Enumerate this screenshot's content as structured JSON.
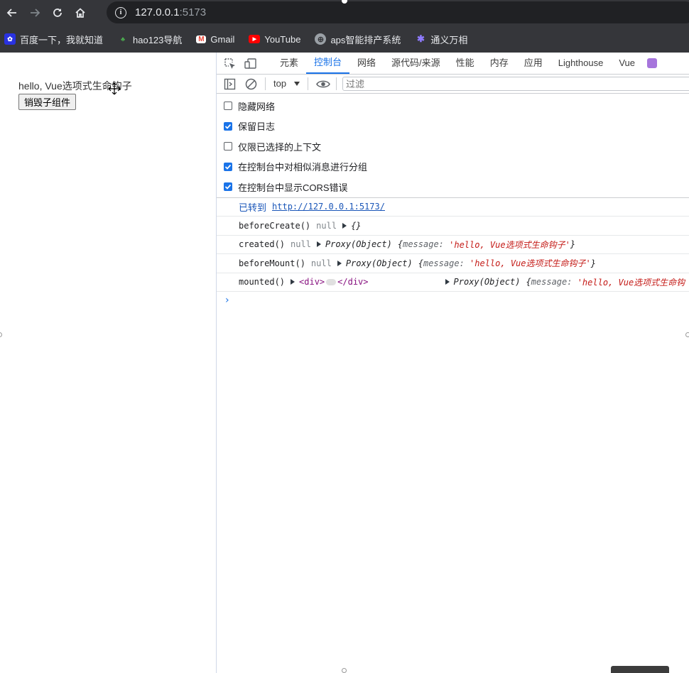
{
  "browser": {
    "url_host": "127.0.0.1",
    "url_port": ":5173",
    "bookmarks": [
      {
        "label": "百度一下，我就知道",
        "icon": "baidu-paw-icon",
        "color": "#2932e1"
      },
      {
        "label": "hao123导航",
        "icon": "hao123-icon",
        "color": "#e8a93a"
      },
      {
        "label": "Gmail",
        "icon": "gmail-icon",
        "color": "#ea4335"
      },
      {
        "label": "YouTube",
        "icon": "youtube-icon",
        "color": "#ff0000"
      },
      {
        "label": "aps智能排产系统",
        "icon": "globe-icon",
        "color": "#9aa0a6"
      },
      {
        "label": "通义万相",
        "icon": "tongyi-icon",
        "color": "#7b61ff"
      }
    ]
  },
  "page": {
    "text": "hello, Vue选项式生命钩子",
    "button_label": "销毁子组件"
  },
  "devtools": {
    "tabs": [
      "元素",
      "控制台",
      "网络",
      "源代码/来源",
      "性能",
      "内存",
      "应用",
      "Lighthouse",
      "Vue"
    ],
    "active_tab": "控制台",
    "context": "top",
    "filter_placeholder": "过滤",
    "settings": [
      {
        "label": "隐藏网络",
        "checked": false
      },
      {
        "label": "保留日志",
        "checked": true
      },
      {
        "label": "仅限已选择的上下文",
        "checked": false
      },
      {
        "label": "在控制台中对相似消息进行分组",
        "checked": true
      },
      {
        "label": "在控制台中显示CORS错误",
        "checked": true
      }
    ],
    "navigated_label": "已转到",
    "navigated_url": "http://127.0.0.1:5173/",
    "logs": {
      "before_create": {
        "fn": "beforeCreate()",
        "nul": "null",
        "obj": "{}"
      },
      "created": {
        "fn": "created()",
        "nul": "null",
        "proxy": "Proxy(Object)",
        "key": "message",
        "str": "'hello, Vue选项式生命钩子'"
      },
      "before_mount": {
        "fn": "beforeMount()",
        "nul": "null",
        "proxy": "Proxy(Object)",
        "key": "message",
        "str": "'hello, Vue选项式生命钩子'"
      },
      "mounted": {
        "fn": "mounted()",
        "open_tag": "<div>",
        "close_tag": "</div>",
        "proxy": "Proxy(Object)",
        "key": "message",
        "str": "'hello, Vue选项式生命钩"
      }
    },
    "prompt": "›"
  },
  "colors": {
    "accent": "#1a73e8",
    "chrome_bg": "#35363a",
    "string": "#c41a16"
  }
}
